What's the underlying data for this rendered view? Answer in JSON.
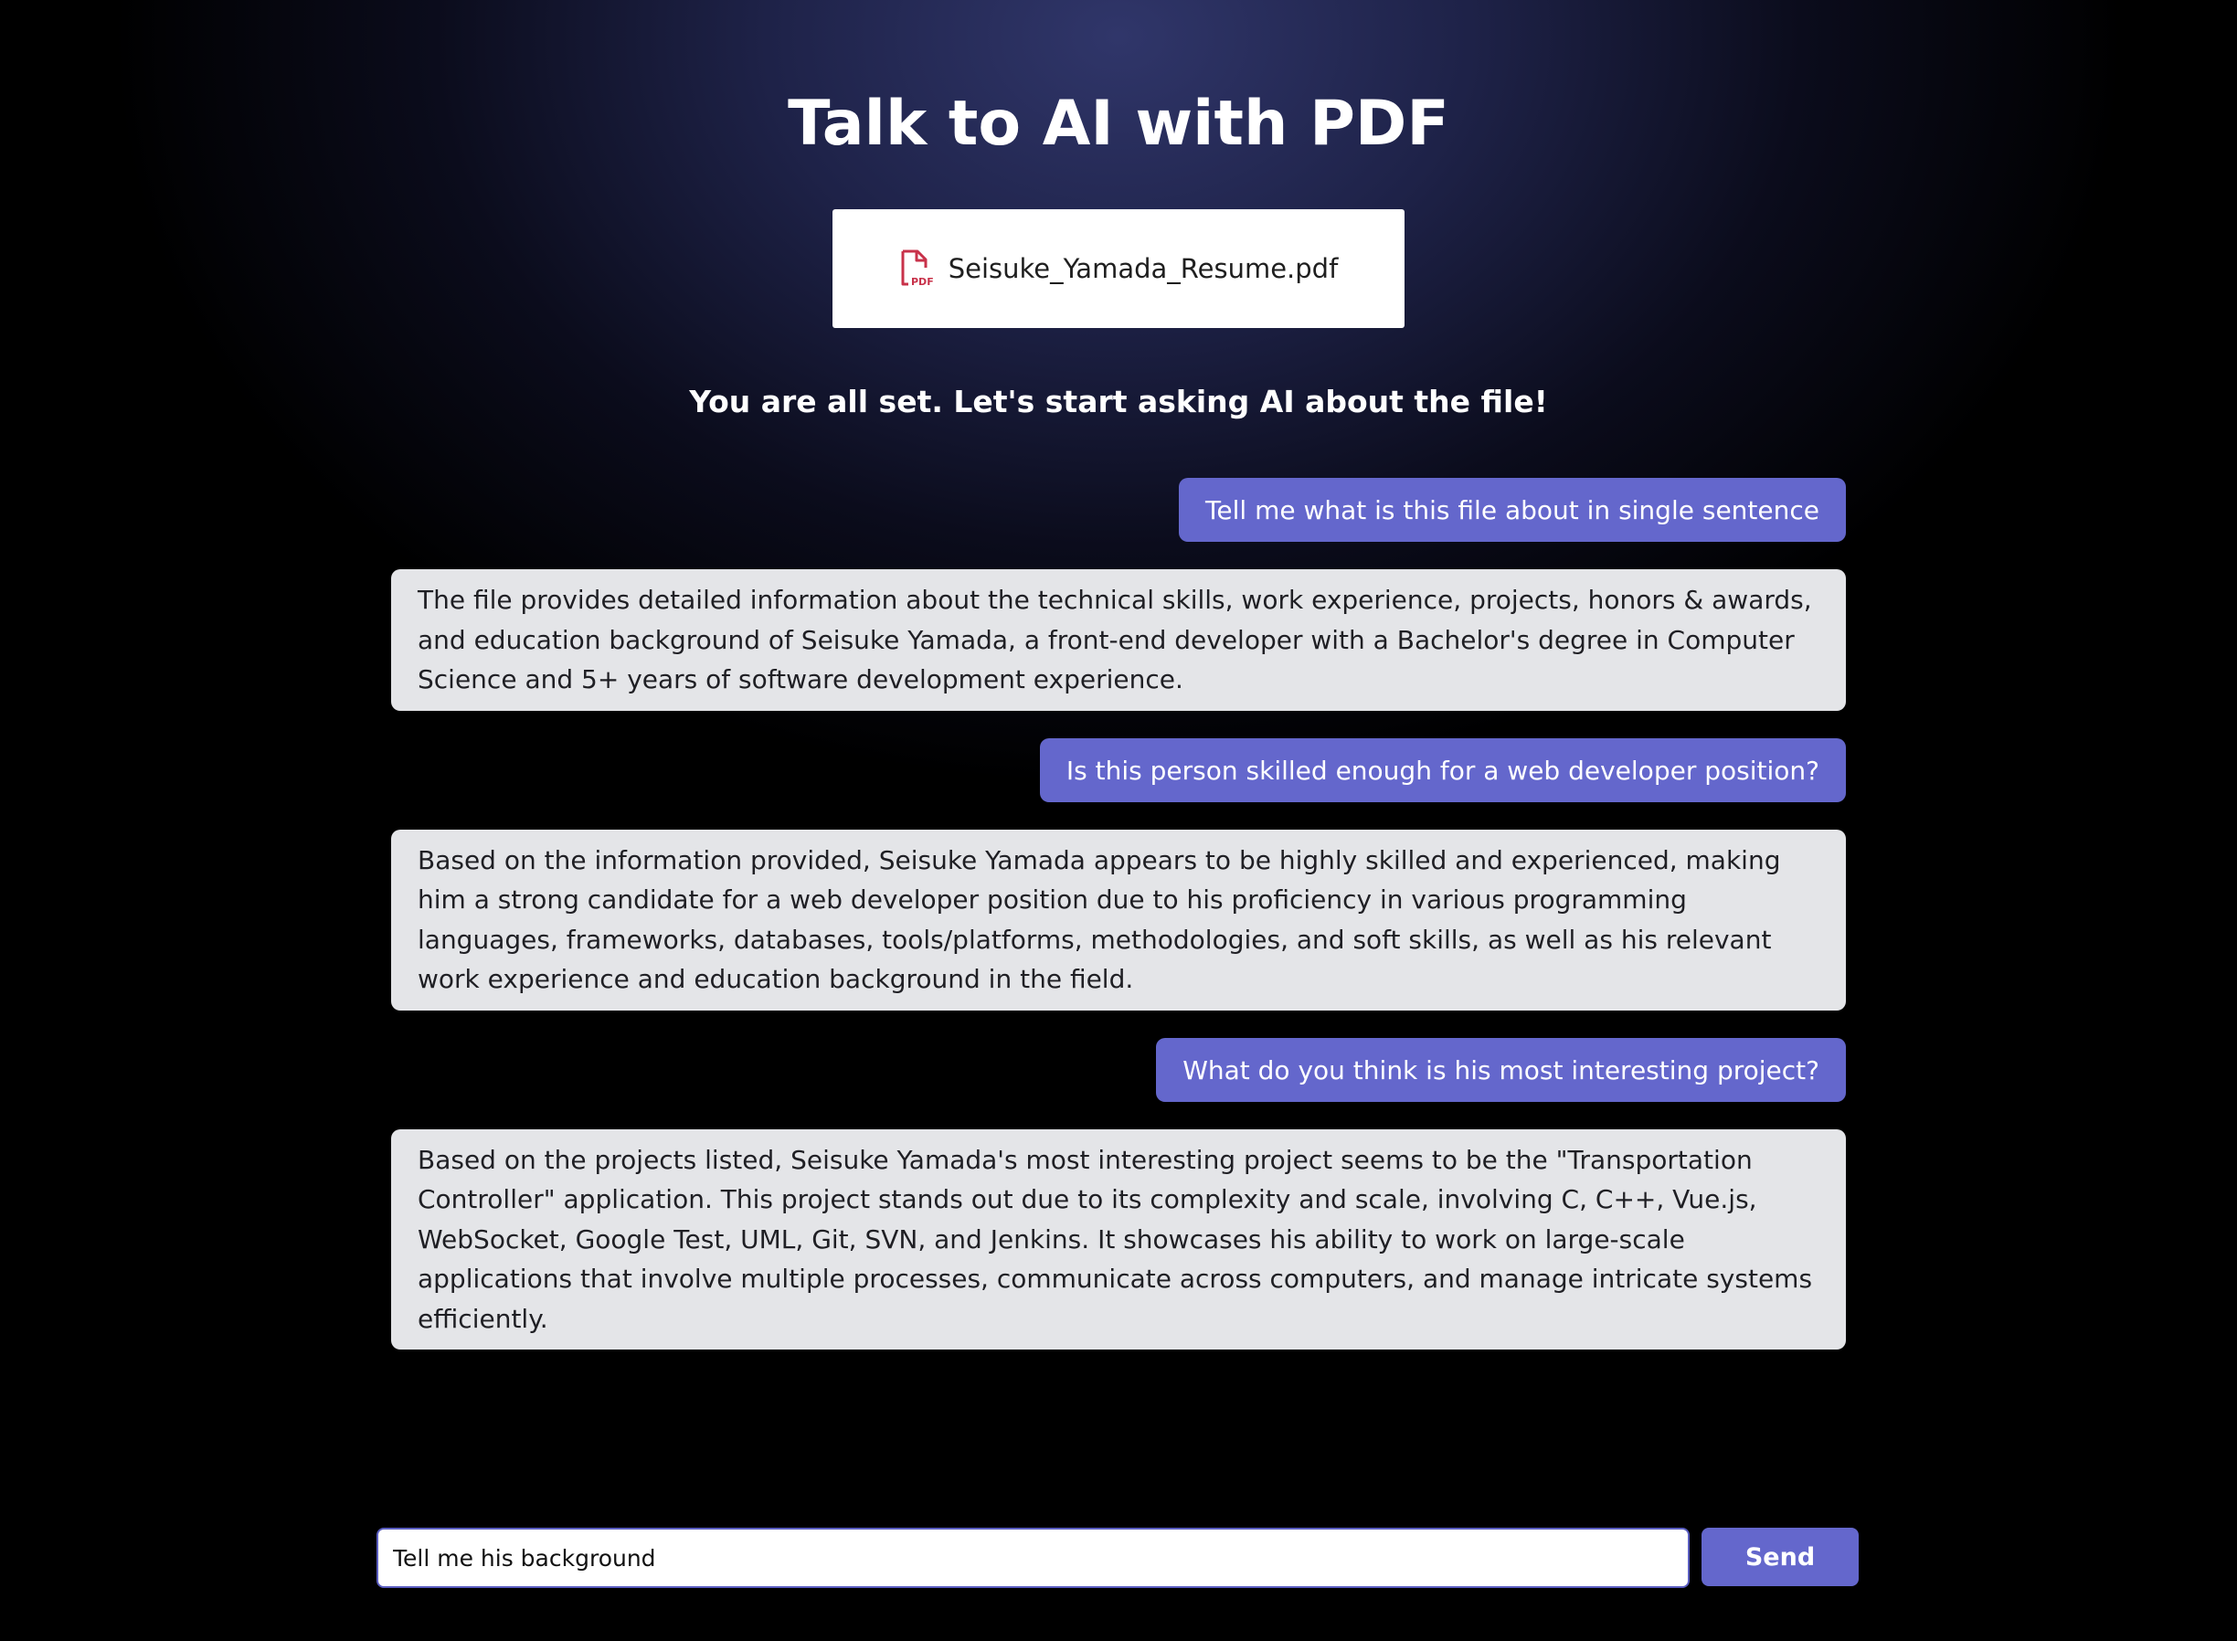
{
  "header": {
    "title": "Talk to AI with PDF"
  },
  "file": {
    "name": "Seisuke_Yamada_Resume.pdf",
    "icon": "pdf-file-icon",
    "icon_color": "#c8324a"
  },
  "status": {
    "message": "You are all set. Let's start asking AI about the file!"
  },
  "messages": [
    {
      "role": "user",
      "text": "Tell me what is this file about in single sentence"
    },
    {
      "role": "ai",
      "text": "The file provides detailed information about the technical skills, work experience, projects, honors & awards, and education background of Seisuke Yamada, a front-end developer with a Bachelor's degree in Computer Science and 5+ years of software development experience."
    },
    {
      "role": "user",
      "text": "Is this person skilled enough for a web developer position?"
    },
    {
      "role": "ai",
      "text": "Based on the information provided, Seisuke Yamada appears to be highly skilled and experienced, making him a strong candidate for a web developer position due to his proficiency in various programming languages, frameworks, databases, tools/platforms, methodologies, and soft skills, as well as his relevant work experience and education background in the field."
    },
    {
      "role": "user",
      "text": "What do you think is his most interesting project?"
    },
    {
      "role": "ai",
      "text": "Based on the projects listed, Seisuke Yamada's most interesting project seems to be the \"Transportation Controller\" application. This project stands out due to its complexity and scale, involving C, C++, Vue.js, WebSocket, Google Test, UML, Git, SVN, and Jenkins. It showcases his ability to work on large-scale applications that involve multiple processes, communicate across computers, and manage intricate systems efficiently."
    }
  ],
  "composer": {
    "input_value": "Tell me his background",
    "send_label": "Send"
  },
  "colors": {
    "accent": "#6467cc",
    "ai_bubble": "#e4e5e8",
    "background_top": "#30366a",
    "background_bottom": "#000000"
  }
}
